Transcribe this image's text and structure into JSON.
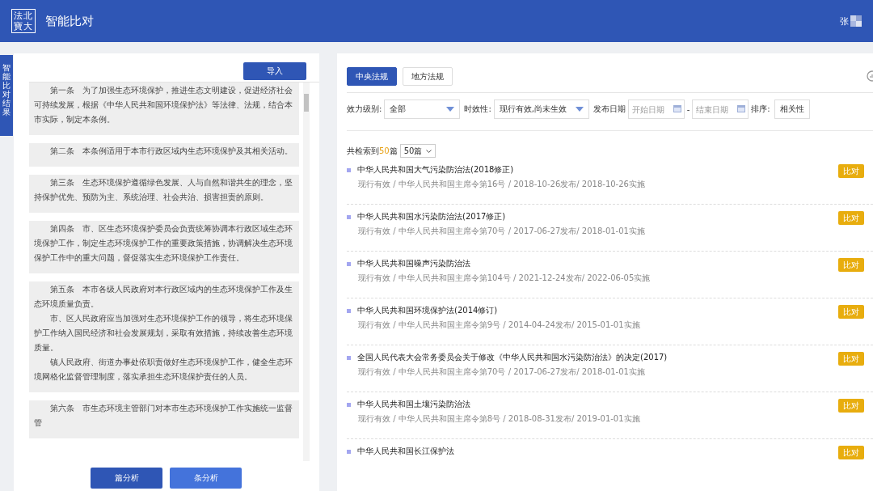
{
  "header": {
    "logo": [
      "法北",
      "寶大"
    ],
    "title": "智能比对",
    "user": "张"
  },
  "side_tab": {
    "label": "智能比对结果"
  },
  "left": {
    "import_button": "导入",
    "articles": [
      {
        "paragraphs": [
          "第一条　为了加强生态环境保护，推进生态文明建设，促进经济社会可持续发展，根据《中华人民共和国环境保护法》等法律、法规，结合本市实际，制定本条例。"
        ]
      },
      {
        "paragraphs": [
          "第二条　本条例适用于本市行政区域内生态环境保护及其相关活动。"
        ]
      },
      {
        "paragraphs": [
          "第三条　生态环境保护遵循绿色发展、人与自然和谐共生的理念，坚持保护优先、预防为主、系统治理、社会共治、损害担责的原则。"
        ]
      },
      {
        "paragraphs": [
          "第四条　市、区生态环境保护委员会负责统筹协调本行政区域生态环境保护工作，制定生态环境保护工作的重要政策措施，协调解决生态环境保护工作中的重大问题，督促落实生态环境保护工作责任。"
        ]
      },
      {
        "paragraphs": [
          "第五条　本市各级人民政府对本行政区域内的生态环境保护工作及生态环境质量负责。",
          "市、区人民政府应当加强对生态环境保护工作的领导，将生态环境保护工作纳入国民经济和社会发展规划，采取有效措施，持续改善生态环境质量。",
          "镇人民政府、街道办事处依职责做好生态环境保护工作，健全生态环境网格化监督管理制度，落实承担生态环境保护责任的人员。"
        ]
      },
      {
        "paragraphs": [
          "第六条　市生态环境主管部门对本市生态环境保护工作实施统一监督管"
        ]
      }
    ],
    "buttons": [
      {
        "label": "篇分析",
        "kind": "dark"
      },
      {
        "label": "条分析",
        "kind": "light"
      }
    ]
  },
  "right": {
    "tabs": [
      {
        "label": "中央法规",
        "selected": true
      },
      {
        "label": "地方法规",
        "selected": false
      }
    ],
    "filters": {
      "level_label": "效力级别:",
      "level_value": "全部",
      "validity_label": "时效性:",
      "validity_value": "现行有效,尚未生效",
      "date_label": "发布日期",
      "start_placeholder": "开始日期",
      "date_separator": "-",
      "end_placeholder": "结束日期",
      "sort_label": "排序:",
      "sort_value": "相关性"
    },
    "count": {
      "prefix": "共检索到",
      "value": "50",
      "suffix": "篇",
      "page_size": "50篇"
    },
    "results": [
      {
        "title": "中华人民共和国大气污染防治法(2018修正)",
        "meta": "现行有效 / 中华人民共和国主席令第16号 / 2018-10-26发布/ 2018-10-26实施",
        "action": "比对"
      },
      {
        "title": "中华人民共和国水污染防治法(2017修正)",
        "meta": "现行有效 / 中华人民共和国主席令第70号 / 2017-06-27发布/ 2018-01-01实施",
        "action": "比对"
      },
      {
        "title": "中华人民共和国噪声污染防治法",
        "meta": "现行有效 / 中华人民共和国主席令第104号 / 2021-12-24发布/ 2022-06-05实施",
        "action": "比对"
      },
      {
        "title": "中华人民共和国环境保护法(2014修订)",
        "meta": "现行有效 / 中华人民共和国主席令第9号 / 2014-04-24发布/ 2015-01-01实施",
        "action": "比对"
      },
      {
        "title": "全国人民代表大会常务委员会关于修改《中华人民共和国水污染防治法》的决定(2017)",
        "meta": "现行有效 / 中华人民共和国主席令第70号 / 2017-06-27发布/ 2018-01-01实施",
        "action": "比对"
      },
      {
        "title": "中华人民共和国土壤污染防治法",
        "meta": "现行有效 / 中华人民共和国主席令第8号 / 2018-08-31发布/ 2019-01-01实施",
        "action": "比对"
      },
      {
        "title": "中华人民共和国长江保护法",
        "action": "比对"
      }
    ]
  }
}
